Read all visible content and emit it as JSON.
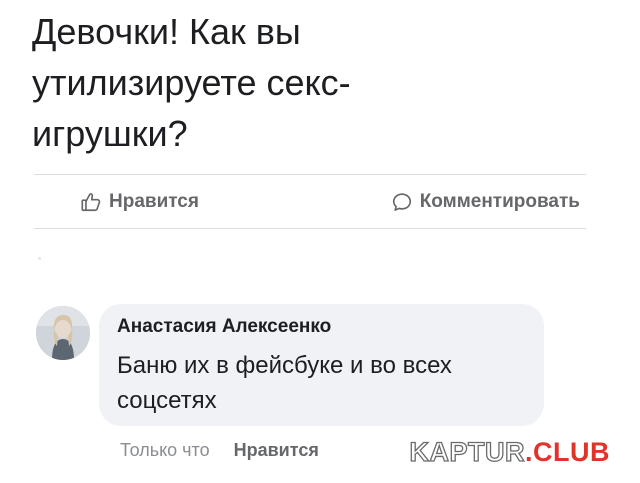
{
  "post": {
    "lines": [
      "Девочки! Как вы",
      "утилизируете секс-",
      "игрушки?"
    ]
  },
  "actions": {
    "like_label": "Нравится",
    "like_icon": "thumbs-up-icon",
    "comment_label": "Комментировать",
    "comment_icon": "speech-bubble-icon"
  },
  "comment": {
    "author": "Анастасия Алексеенко",
    "text_lines": [
      "Баню их в фейсбуке и во всех",
      "соцсетях"
    ],
    "time": "Только что",
    "like_label": "Нравится"
  },
  "watermark": {
    "part1": "KAPTUR",
    "part2": ".CLUB"
  },
  "colors": {
    "text": "#1c1e21",
    "muted": "#65676b",
    "bubble": "#f0f2f5",
    "divider": "#dadde1",
    "watermark_red": "#e0332a"
  }
}
